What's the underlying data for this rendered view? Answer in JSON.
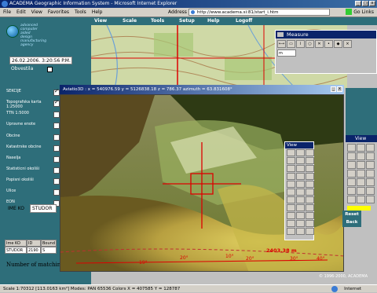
{
  "window": {
    "title": "ACADEMA Geographic Information System - Microsoft Internet Explorer",
    "buttons": [
      "_",
      "□",
      "x"
    ]
  },
  "menu": [
    "File",
    "Edit",
    "View",
    "Favorites",
    "Tools",
    "Help"
  ],
  "address": {
    "label": "Address",
    "url": "http://www.academa.si:81/start_i.htm",
    "go": "Go",
    "links": "Links"
  },
  "logo": {
    "text": "advanced\ncomputer\naided\ndesign\nmanufacturing\nagency"
  },
  "sidebar": {
    "datetime": "26.02.2006. 3:20:56 P.M.",
    "obvestila": "Obvestila",
    "layers": [
      {
        "label": "SEKCIJE",
        "checked": true
      },
      {
        "label": "Topografska karta 1:25000",
        "checked": true
      },
      {
        "label": "TTN 1:5000",
        "checked": false
      },
      {
        "label": "Upravne enote",
        "checked": false
      },
      {
        "label": "Obcine",
        "checked": false
      },
      {
        "label": "Katastrske obcine",
        "checked": false
      },
      {
        "label": "Naselja",
        "checked": false
      },
      {
        "label": "Statisticni okoliši",
        "checked": false
      },
      {
        "label": "Popisni okoliši",
        "checked": false
      },
      {
        "label": "Ulice",
        "checked": false
      },
      {
        "label": "EON",
        "checked": false
      }
    ],
    "imeko_label": "IME KO",
    "imeko_value": "STUDOR",
    "result_headers": [
      "Ime KO",
      "ID",
      "Bound"
    ],
    "result_row": [
      "STUDOR",
      "2190",
      "S"
    ],
    "matching": "Number of matching r"
  },
  "toptabs": [
    "View",
    "Scale",
    "Tools",
    "Setup",
    "Help",
    "Logoff"
  ],
  "aviatio": {
    "title": "Aviatio3D  : x = 540976.59  y = 5126838.18  z =     786.37  azimuth =   63.831608°",
    "marks": [
      "19°",
      "20°",
      "10°",
      "20°",
      "30°",
      "40°"
    ],
    "distance": "2403.38 m"
  },
  "measure": {
    "title": "Measure",
    "unit": "m"
  },
  "viewpal": {
    "title": "View"
  },
  "rightview": {
    "title": "View"
  },
  "buttons": {
    "reset": "Reset",
    "back": "Back"
  },
  "copyright": "© 1996-2000, ACADEMA",
  "status": {
    "left": "Scale 1:70312 [113.0163 km²]  Modes: PAN 65536  Colors  X = 407585  Y = 128787",
    "zone": "Internet"
  },
  "colors": {
    "panel": "#2e6e7a",
    "title": "#0a246a"
  }
}
